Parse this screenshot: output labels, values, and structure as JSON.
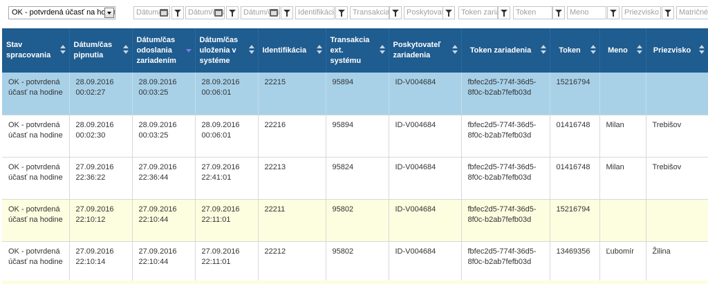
{
  "filters": {
    "status_select": "OK - potvrdená účasť na hodine",
    "inputs": [
      "Dátum/čas",
      "Dátum/čas",
      "Dátum/čas",
      "Identifikácia",
      "Transakcia",
      "Poskytovateľ",
      "Token zariadenia",
      "Token",
      "Meno",
      "Priezvisko",
      "Matričné"
    ]
  },
  "columns": [
    {
      "label": "Stav spracovania",
      "sort": "none"
    },
    {
      "label": "Dátum/čas pipnutia",
      "sort": "none"
    },
    {
      "label": "Dátum/čas odoslania zariadením",
      "sort": "desc"
    },
    {
      "label": "Dátum/čas uloženia v systéme",
      "sort": "none"
    },
    {
      "label": "Identifikácia",
      "sort": "none"
    },
    {
      "label": "Transakcia ext. systému",
      "sort": "none"
    },
    {
      "label": "Poskytovateľ zariadenia",
      "sort": "none"
    },
    {
      "label": "Token zariadenia",
      "sort": "none"
    },
    {
      "label": "Token",
      "sort": "none"
    },
    {
      "label": "Meno",
      "sort": "none"
    },
    {
      "label": "Priezvisko",
      "sort": "none"
    }
  ],
  "rows": [
    {
      "style": "selected",
      "cells": [
        "OK - potvrdená účasť na hodine",
        "28.09.2016 00:02:27",
        "28.09.2016 00:03:25",
        "28.09.2016 00:06:01",
        "22215",
        "95894",
        "ID-V004684",
        "fbfec2d5-774f-36d5-8f0c-b2ab7fefb03d",
        "15216794",
        "",
        ""
      ]
    },
    {
      "style": "white",
      "cells": [
        "OK - potvrdená účasť na hodine",
        "28.09.2016 00:02:30",
        "28.09.2016 00:03:25",
        "28.09.2016 00:06:01",
        "22216",
        "95894",
        "ID-V004684",
        "fbfec2d5-774f-36d5-8f0c-b2ab7fefb03d",
        "01416748",
        "Milan",
        "Trebišov"
      ]
    },
    {
      "style": "white",
      "cells": [
        "OK - potvrdená účasť na hodine",
        "27.09.2016 22:36:22",
        "27.09.2016 22:36:44",
        "27.09.2016 22:41:01",
        "22213",
        "95824",
        "ID-V004684",
        "fbfec2d5-774f-36d5-8f0c-b2ab7fefb03d",
        "01416748",
        "Milan",
        "Trebišov"
      ]
    },
    {
      "style": "yellow",
      "cells": [
        "OK - potvrdená účasť na hodine",
        "27.09.2016 22:10:12",
        "27.09.2016 22:10:44",
        "27.09.2016 22:11:01",
        "22211",
        "95802",
        "ID-V004684",
        "fbfec2d5-774f-36d5-8f0c-b2ab7fefb03d",
        "15216794",
        "",
        ""
      ]
    },
    {
      "style": "white",
      "cells": [
        "OK - potvrdená účasť na hodine",
        "27.09.2016 22:10:14",
        "27.09.2016 22:10:44",
        "27.09.2016 22:11:01",
        "22212",
        "95802",
        "ID-V004684",
        "fbfec2d5-774f-36d5-8f0c-b2ab7fefb03d",
        "13469356",
        "Ľubomír",
        "Žilina"
      ]
    }
  ],
  "colors": {
    "header_bg": "#1f5c8f",
    "selected_row": "#a8d1e8",
    "highlight_row": "#fdfde0"
  }
}
